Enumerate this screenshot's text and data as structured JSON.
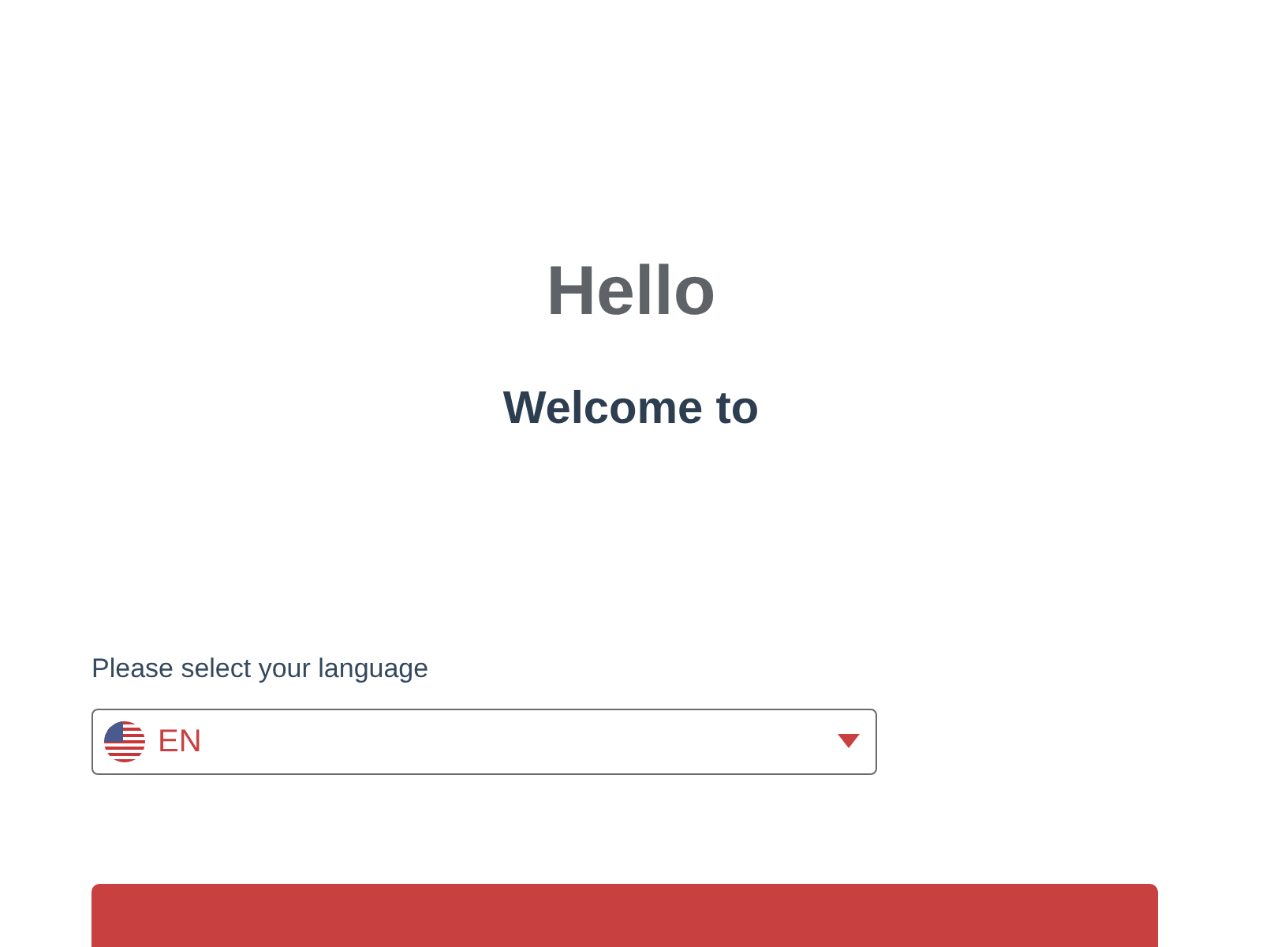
{
  "greeting": "Hello",
  "subtitle": "Welcome to",
  "language": {
    "label": "Please select your language",
    "value": "EN"
  }
}
